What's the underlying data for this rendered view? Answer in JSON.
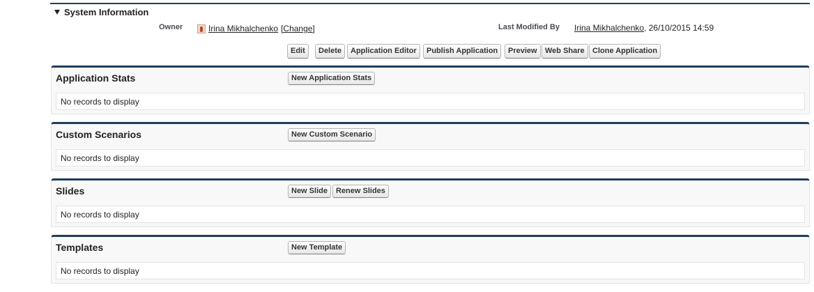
{
  "system_information": {
    "title": "System Information",
    "owner_label": "Owner",
    "owner_name": "Irina Mikhalchenko",
    "owner_change": "[Change]",
    "last_modified_label": "Last Modified By",
    "last_modified_name": "Irina Mikhalchenko",
    "last_modified_date": ", 26/10/2015 14:59"
  },
  "actions": {
    "edit": "Edit",
    "delete": "Delete",
    "application_editor": "Application Editor",
    "publish_application": "Publish Application",
    "preview": "Preview",
    "web_share": "Web Share",
    "clone_application": "Clone Application"
  },
  "related_lists": [
    {
      "title": "Application Stats",
      "buttons": [
        "New Application Stats"
      ],
      "empty": "No records to display"
    },
    {
      "title": "Custom Scenarios",
      "buttons": [
        "New Custom Scenario"
      ],
      "empty": "No records to display"
    },
    {
      "title": "Slides",
      "buttons": [
        "New Slide",
        "Renew Slides"
      ],
      "empty": "No records to display"
    },
    {
      "title": "Templates",
      "buttons": [
        "New Template"
      ],
      "empty": "No records to display"
    }
  ],
  "colors": {
    "header_border": "#1f3d5a",
    "panel_bg": "#f8f8f8"
  }
}
